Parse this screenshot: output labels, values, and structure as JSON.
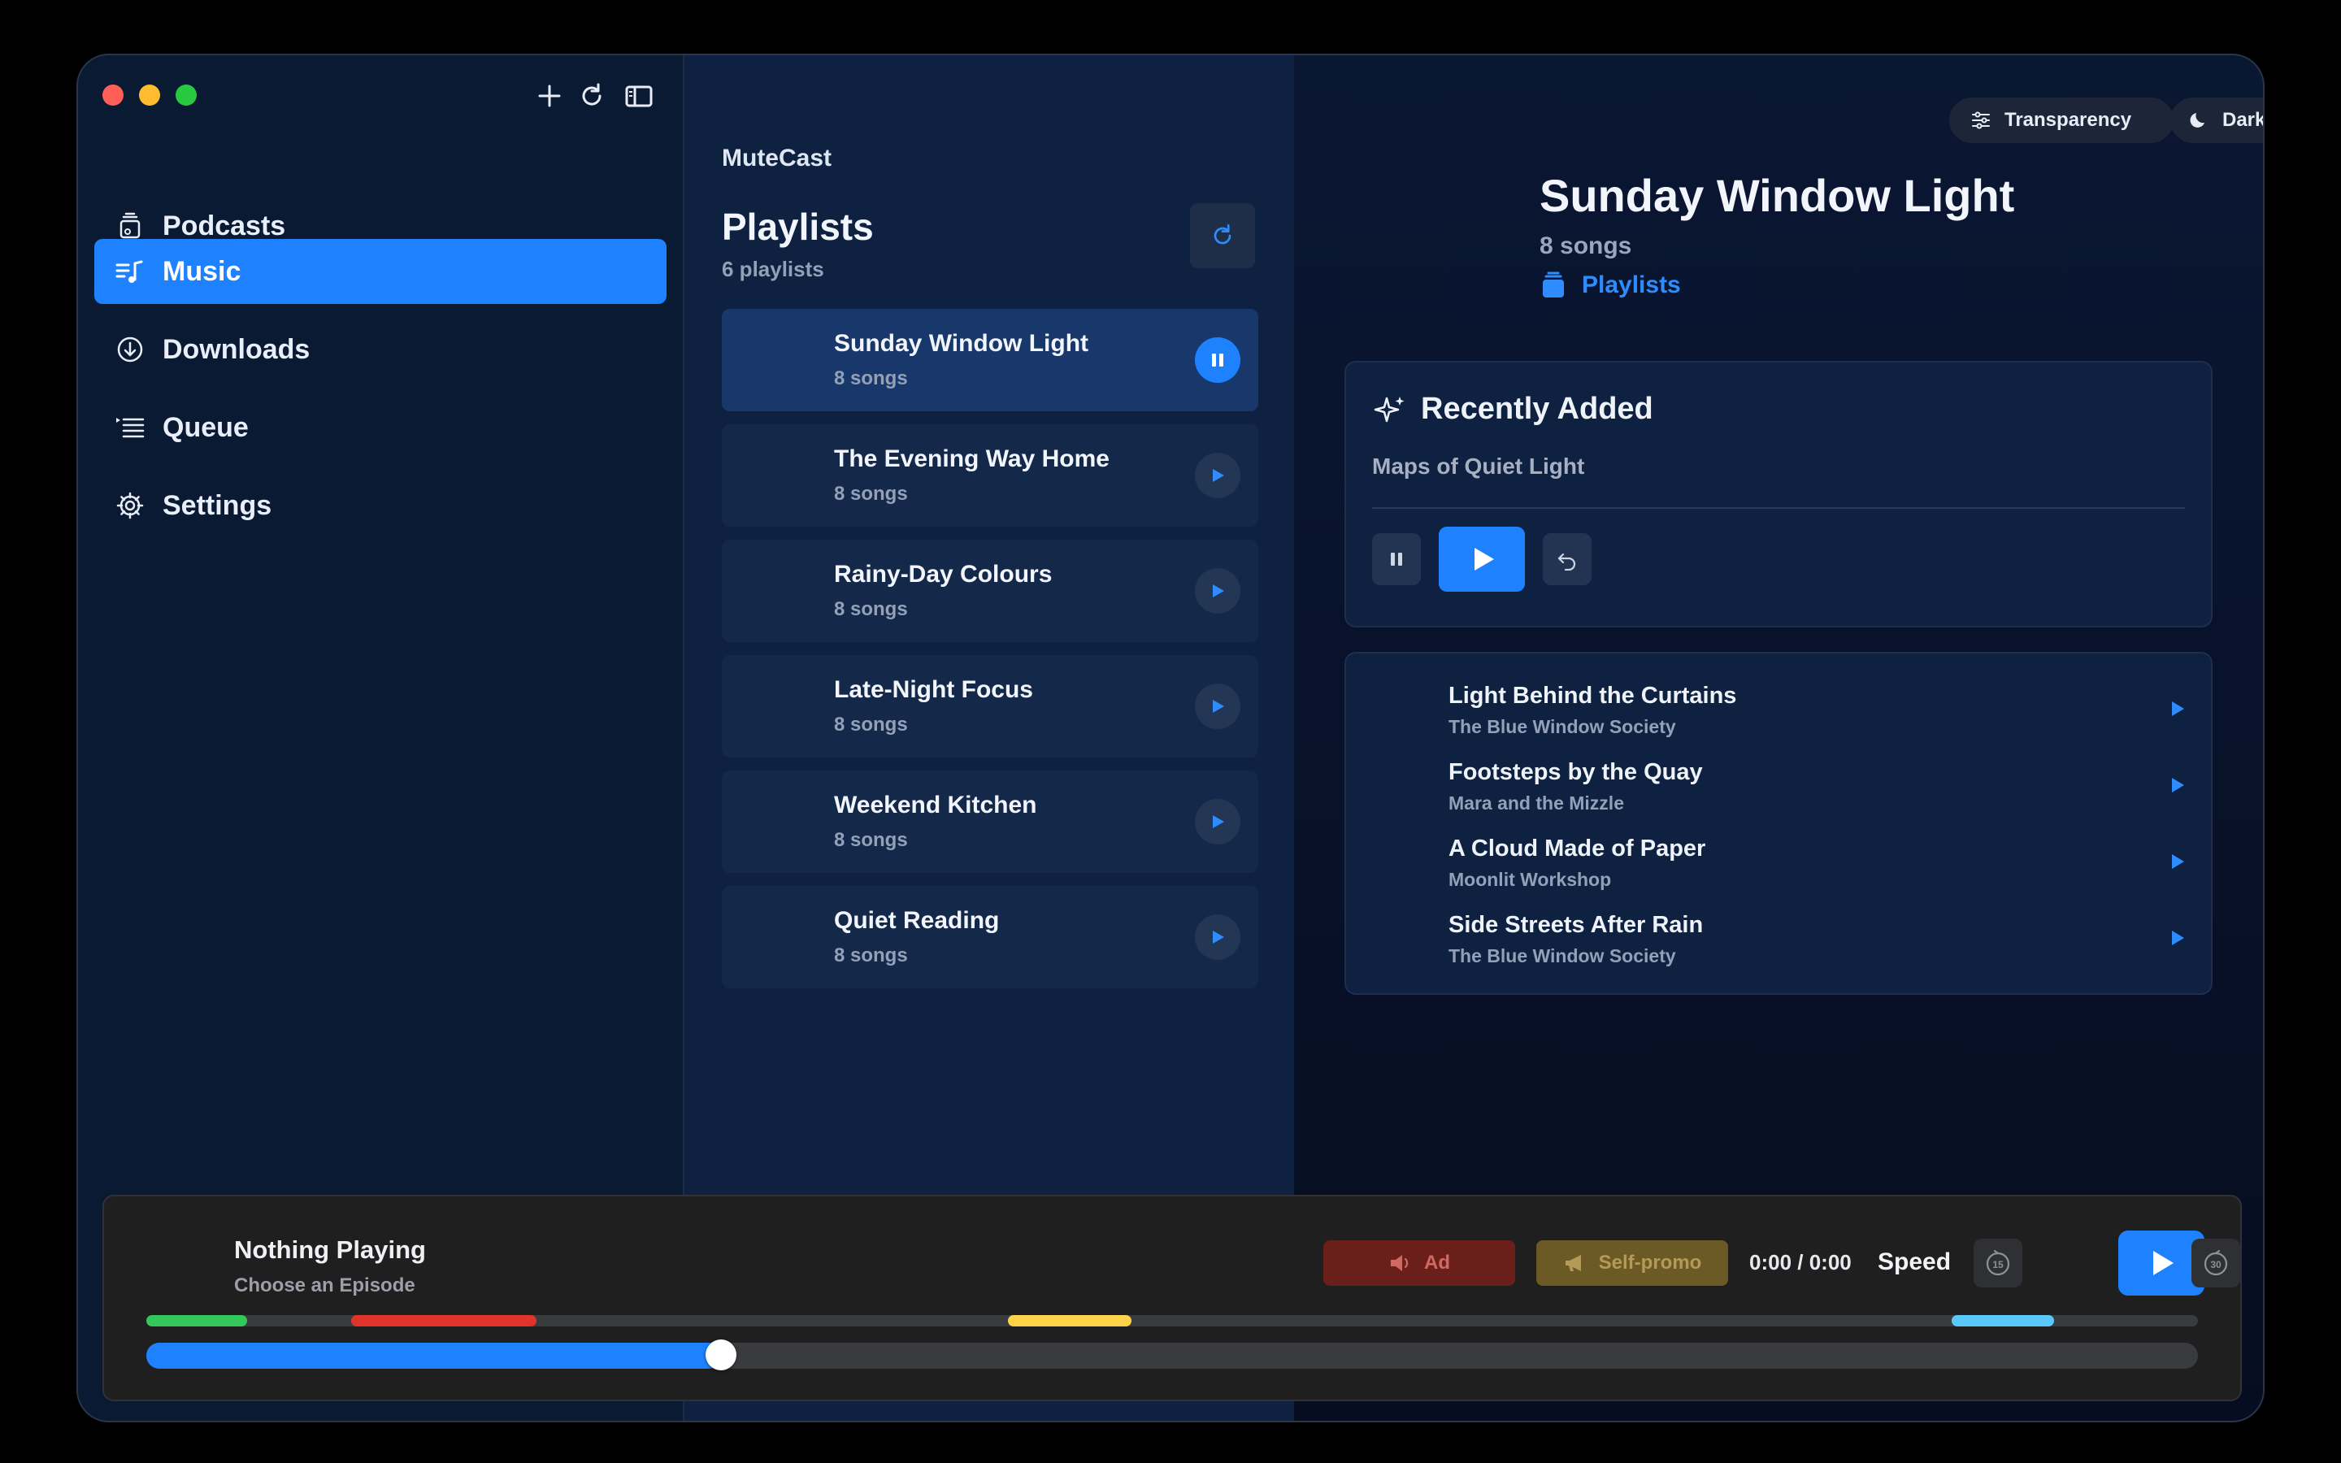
{
  "app": {
    "name": "MuteCast"
  },
  "sidebar": {
    "items": [
      {
        "label": "Podcasts",
        "icon": "podcasts-icon"
      },
      {
        "label": "Music",
        "icon": "music-list-icon",
        "active": true
      },
      {
        "label": "Downloads",
        "icon": "download-icon"
      },
      {
        "label": "Queue",
        "icon": "queue-icon"
      },
      {
        "label": "Settings",
        "icon": "gear-icon"
      }
    ]
  },
  "playlists": {
    "title": "Playlists",
    "count_label": "6 playlists",
    "items": [
      {
        "name": "Sunday Window Light",
        "sub": "8 songs",
        "active": true,
        "state": "playing"
      },
      {
        "name": "The Evening Way Home",
        "sub": "8 songs"
      },
      {
        "name": "Rainy-Day Colours",
        "sub": "8 songs"
      },
      {
        "name": "Late-Night Focus",
        "sub": "8 songs"
      },
      {
        "name": "Weekend Kitchen",
        "sub": "8 songs"
      },
      {
        "name": "Quiet Reading",
        "sub": "8 songs"
      }
    ]
  },
  "toolbar": {
    "transparency_label": "Transparency",
    "dark_label": "Dark"
  },
  "detail": {
    "title": "Sunday Window Light",
    "subtitle": "8 songs",
    "link_label": "Playlists",
    "recently_added": {
      "title": "Recently Added",
      "track": "Maps of Quiet Light"
    },
    "songs": [
      {
        "title": "Light Behind the Curtains",
        "artist": "The Blue Window Society"
      },
      {
        "title": "Footsteps by the Quay",
        "artist": "Mara and the Mizzle"
      },
      {
        "title": "A Cloud Made of Paper",
        "artist": "Moonlit Workshop"
      },
      {
        "title": "Side Streets After Rain",
        "artist": "The Blue Window Society"
      }
    ]
  },
  "player": {
    "title": "Nothing Playing",
    "subtitle": "Choose an Episode",
    "ad_label": "Ad",
    "selfpromo_label": "Self-promo",
    "time": "0:00 / 0:00",
    "speed_label": "Speed",
    "skip_back_label": "15",
    "skip_forward_label": "30",
    "progress": 0.28,
    "segments": [
      {
        "type": "intro",
        "color": "#34c759",
        "start": 0.0,
        "end": 0.049
      },
      {
        "type": "ad",
        "color": "#e0342b",
        "start": 0.1,
        "end": 0.19
      },
      {
        "type": "self-promo",
        "color": "#ffd34a",
        "start": 0.42,
        "end": 0.48
      },
      {
        "type": "outro",
        "color": "#5ac8fa",
        "start": 0.88,
        "end": 0.93
      }
    ]
  },
  "colors": {
    "accent": "#1e82ff",
    "sidebar_bg": "#0a1a33",
    "list_bg": "#0f2140"
  }
}
